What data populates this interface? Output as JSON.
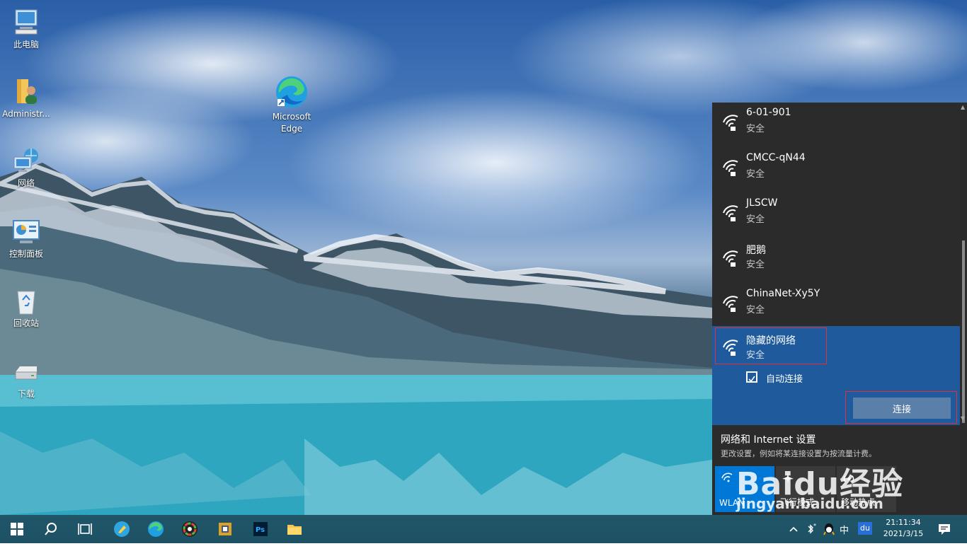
{
  "desktop_icons": [
    {
      "label": "此电脑",
      "icon": "computer-icon"
    },
    {
      "label": "Administr...",
      "icon": "user-folder-icon"
    },
    {
      "label": "网络",
      "icon": "network-icon"
    },
    {
      "label": "控制面板",
      "icon": "control-panel-icon"
    },
    {
      "label": "回收站",
      "icon": "recycle-bin-icon"
    },
    {
      "label": "下载",
      "icon": "drive-icon"
    },
    {
      "label": "Microsoft Edge",
      "icon": "edge-icon"
    }
  ],
  "network_flyout": {
    "networks": [
      {
        "ssid": "6-01-901",
        "security": "安全"
      },
      {
        "ssid": "CMCC-qN44",
        "security": "安全"
      },
      {
        "ssid": "JLSCW",
        "security": "安全"
      },
      {
        "ssid": "肥鹅",
        "security": "安全"
      },
      {
        "ssid": "ChinaNet-Xy5Y",
        "security": "安全"
      }
    ],
    "selected": {
      "ssid": "隐藏的网络",
      "security": "安全",
      "auto_connect_label": "自动连接",
      "auto_connect_checked": true,
      "connect_label": "连接"
    },
    "settings_title": "网络和 Internet 设置",
    "settings_subtitle": "更改设置，例如将某连接设置为按流量计费。",
    "quick_actions": [
      {
        "label": "WLAN",
        "active": true
      },
      {
        "label": "飞行模式",
        "active": false
      },
      {
        "label": "移动热点",
        "active": false
      }
    ]
  },
  "watermark": {
    "brand": "Baidu经验",
    "url": "jingyan.baidu.com"
  },
  "taskbar": {
    "ime_label": "中",
    "du_label": "du",
    "time": "21:11:34",
    "date": "2021/3/15"
  },
  "colors": {
    "flyout_bg": "#2b2b2b",
    "selected_bg": "#1e5a9c",
    "accent": "#0078d7",
    "highlight_border": "#e0303c"
  }
}
